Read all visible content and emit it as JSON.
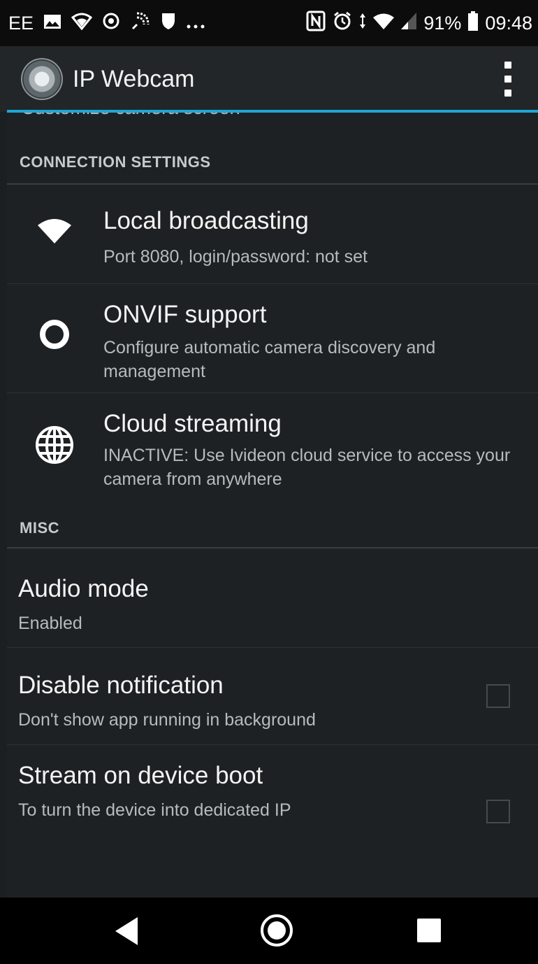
{
  "status_bar": {
    "carrier": "EE",
    "battery": "91%",
    "time": "09:48",
    "icons": [
      "image-icon",
      "wifi-icon",
      "vpn-icon",
      "nfc-signal-icon",
      "shield-icon",
      "more-icon",
      "nfc-icon",
      "alarm-icon",
      "wifi-icon",
      "signal-icon",
      "battery-icon"
    ]
  },
  "app_bar": {
    "title": "IP Webcam",
    "logo_icon": "webcam-lens-icon",
    "menu_icon": "overflow-menu-icon"
  },
  "partial_item": "Customize camera screen",
  "sections": {
    "connection": {
      "header": "CONNECTION SETTINGS",
      "items": [
        {
          "title": "Local broadcasting",
          "subtitle": "Port 8080, login/password: not set",
          "icon": "wifi-icon"
        },
        {
          "title": "ONVIF support",
          "subtitle": "Configure automatic camera discovery and management",
          "icon": "ring-icon"
        },
        {
          "title": "Cloud streaming",
          "subtitle": "INACTIVE: Use Ivideon cloud service to access your camera from anywhere",
          "icon": "globe-icon"
        }
      ]
    },
    "misc": {
      "header": "MISC",
      "items": [
        {
          "title": "Audio mode",
          "subtitle": "Enabled"
        },
        {
          "title": "Disable notification",
          "subtitle": "Don't show app running in background",
          "checked": false
        },
        {
          "title": "Stream on device boot",
          "subtitle": "To turn the device into dedicated IP",
          "checked": false
        }
      ]
    }
  },
  "nav_bar": {
    "icons": [
      "back-icon",
      "home-icon",
      "recents-icon"
    ]
  },
  "colors": {
    "accent": "#1ea7d6",
    "background": "#1e2123",
    "app_bar": "#232629"
  }
}
